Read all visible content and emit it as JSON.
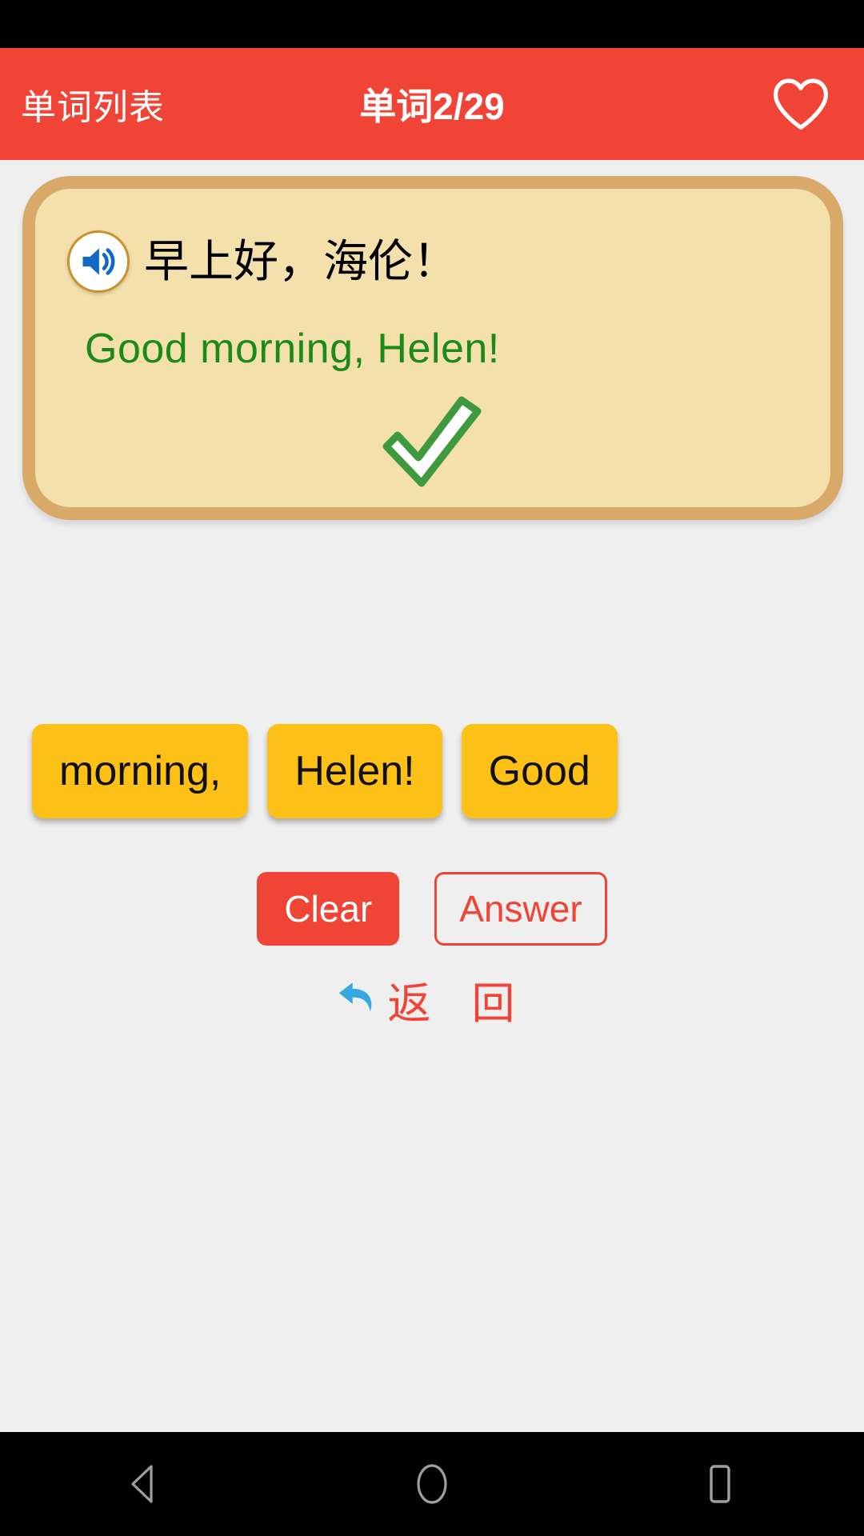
{
  "app": {
    "header": {
      "back_label": "单词列表",
      "title": "单词2/29",
      "favorite_icon": "heart-outline-icon",
      "bg_color": "#ef4436",
      "text_color": "#ffffff"
    },
    "card": {
      "speaker_icon": "speaker-sound-icon",
      "chinese_sentence": "早上好，海伦！",
      "english_sentence": "Good  morning,  Helen!",
      "result_icon": "green-checkmark-icon",
      "bg_color": "#f3e0ab",
      "border_color": "#d9a96a",
      "english_color": "#1b8a1b"
    },
    "word_tiles": [
      {
        "label": "morning,"
      },
      {
        "label": "Helen!"
      },
      {
        "label": "Good"
      }
    ],
    "tile_colors": {
      "bg": "#fcc017",
      "text": "#111111"
    },
    "actions": {
      "clear_label": "Clear",
      "answer_label": "Answer",
      "clear_bg": "#ef4436",
      "answer_border": "#ef4436"
    },
    "return_link": {
      "icon": "undo-arrow-icon",
      "label": "返 回",
      "text_color": "#ef4436",
      "icon_color": "#35a8e0"
    },
    "nav_bar": {
      "back_icon": "triangle-back-icon",
      "home_icon": "circle-home-icon",
      "recents_icon": "square-recents-icon"
    }
  }
}
